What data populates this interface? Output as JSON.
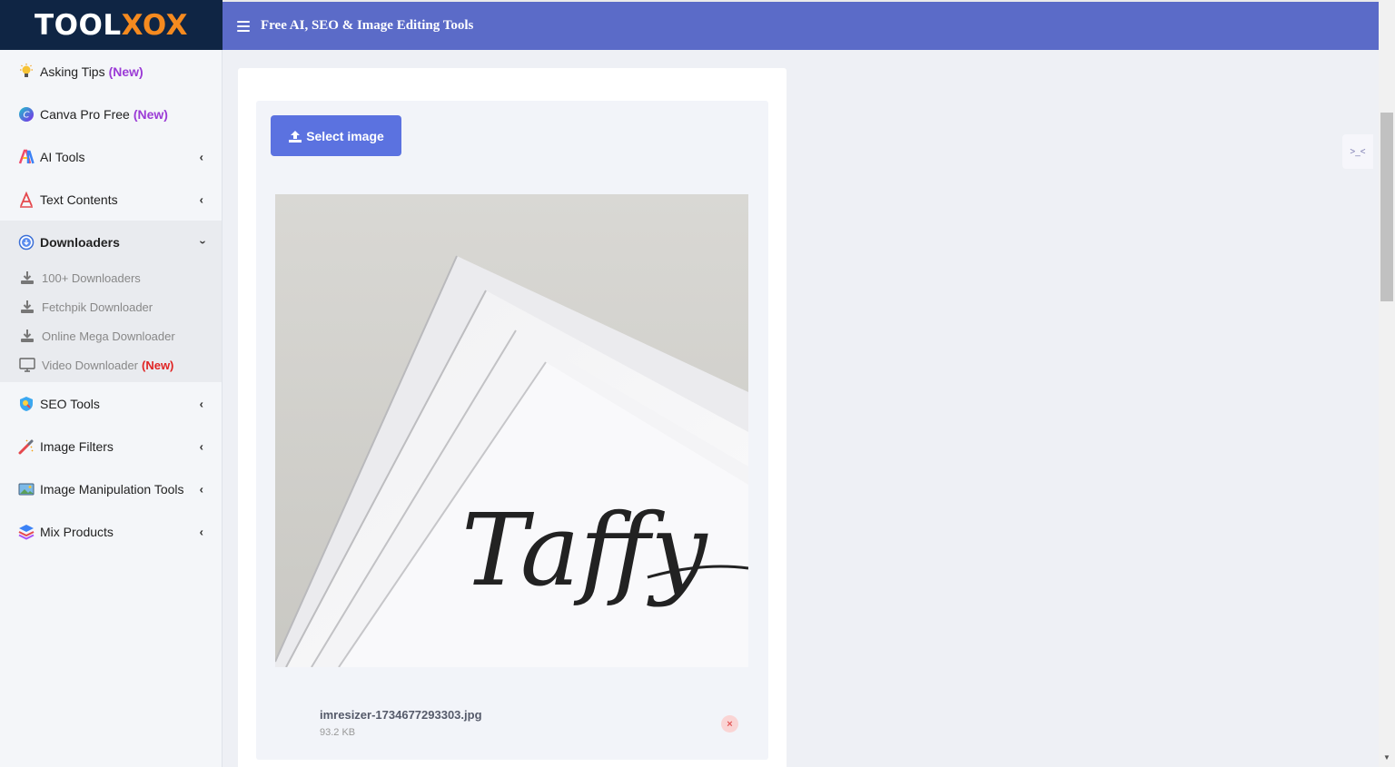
{
  "brand": {
    "logo_part1": "TOOL",
    "logo_part2": "XOX"
  },
  "header": {
    "title": "Free AI, SEO & Image Editing Tools"
  },
  "sidebar": {
    "items": [
      {
        "label": "Asking Tips",
        "badge": "(New)",
        "icon": "lightbulb-icon"
      },
      {
        "label": "Canva Pro Free",
        "badge": "(New)",
        "icon": "canva-icon"
      },
      {
        "label": "AI Tools",
        "icon": "ai-icon"
      },
      {
        "label": "Text Contents",
        "icon": "text-icon"
      },
      {
        "label": "Downloaders",
        "icon": "download-circle-icon"
      },
      {
        "label": "SEO Tools",
        "icon": "seo-icon"
      },
      {
        "label": "Image Filters",
        "icon": "filter-icon"
      },
      {
        "label": "Image Manipulation Tools",
        "icon": "image-tools-icon"
      },
      {
        "label": "Mix Products",
        "icon": "layers-icon"
      }
    ],
    "downloaders_sub": [
      {
        "label": "100+ Downloaders",
        "icon": "download-icon"
      },
      {
        "label": "Fetchpik Downloader",
        "icon": "download-icon"
      },
      {
        "label": "Online Mega Downloader",
        "icon": "download-icon"
      },
      {
        "label": "Video Downloader",
        "badge": "(New)",
        "icon": "monitor-icon"
      }
    ]
  },
  "uploader": {
    "select_label": "Select image",
    "file_name": "imresizer-1734677293303.jpg",
    "file_size": "93.2 KB",
    "remove_symbol": "×",
    "preview_signature": "Taffy"
  },
  "float_button": {
    "symbol": ">_<"
  },
  "colors": {
    "topbar": "#5b6bc8",
    "brand_bg": "#0f2544",
    "accent": "#5b72e0",
    "new_badge": "#9b3bd6",
    "new_badge_red": "#e02424"
  }
}
